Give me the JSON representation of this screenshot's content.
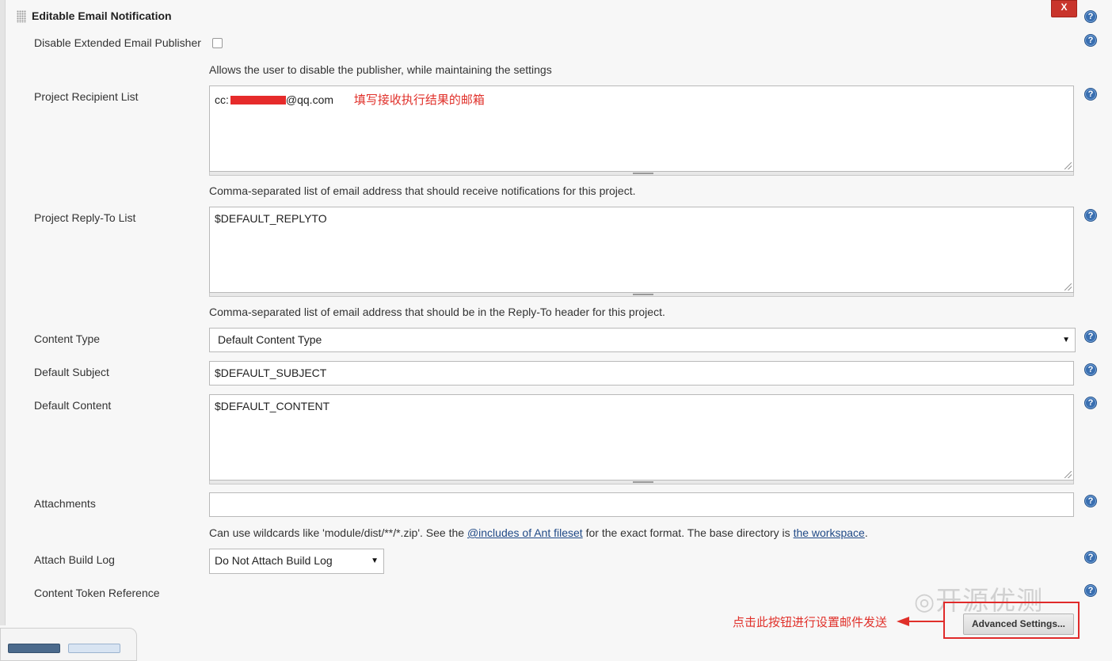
{
  "section": {
    "title": "Editable Email Notification",
    "delete_label": "X"
  },
  "help_glyph": "?",
  "fields": {
    "disable_publisher": {
      "label": "Disable Extended Email Publisher",
      "checked": false,
      "description": "Allows the user to disable the publisher, while maintaining the settings"
    },
    "recipient_list": {
      "label": "Project Recipient List",
      "value_prefix": "cc:",
      "value_suffix": "@qq.com",
      "annotation": "填写接收执行结果的邮箱",
      "description": "Comma-separated list of email address that should receive notifications for this project."
    },
    "reply_to_list": {
      "label": "Project Reply-To List",
      "value": "$DEFAULT_REPLYTO",
      "description": "Comma-separated list of email address that should be in the Reply-To header for this project."
    },
    "content_type": {
      "label": "Content Type",
      "selected": "Default Content Type"
    },
    "default_subject": {
      "label": "Default Subject",
      "value": "$DEFAULT_SUBJECT"
    },
    "default_content": {
      "label": "Default Content",
      "value": "$DEFAULT_CONTENT"
    },
    "attachments": {
      "label": "Attachments",
      "value": "",
      "description_part1": "Can use wildcards like 'module/dist/**/*.zip'. See the ",
      "link1": "@includes of Ant fileset",
      "description_part2": " for the exact format. The base directory is ",
      "link2": "the workspace",
      "description_part3": "."
    },
    "attach_build_log": {
      "label": "Attach Build Log",
      "selected": "Do Not Attach Build Log"
    },
    "content_token_reference": {
      "label": "Content Token Reference"
    }
  },
  "advanced_button": {
    "label": "Advanced Settings..."
  },
  "annotation_arrow_text": "点击此按钮进行设置邮件发送",
  "watermark": "开源优测",
  "colors": {
    "annotation_red": "#e0302a",
    "help_blue": "#3a6fb0",
    "delete_red": "#c9352c"
  }
}
